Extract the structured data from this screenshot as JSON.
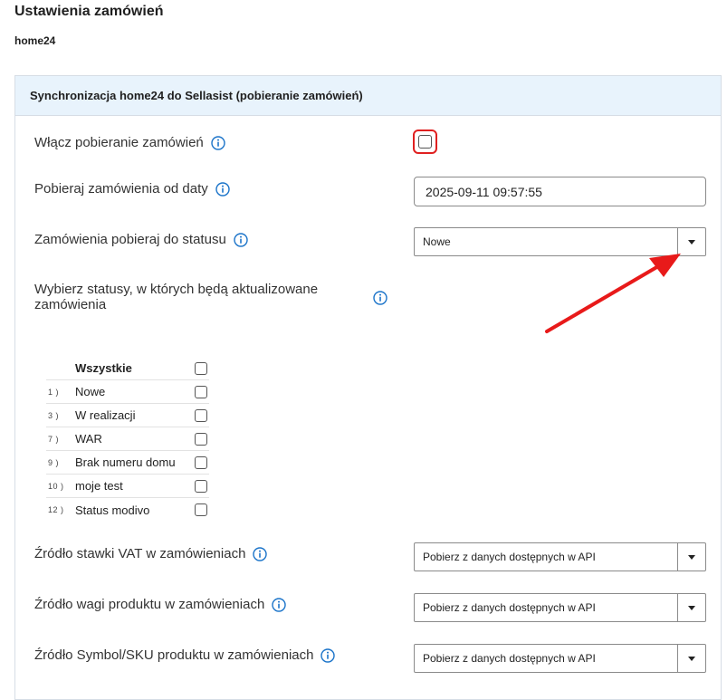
{
  "page": {
    "title": "Ustawienia zamówień",
    "subtitle": "home24"
  },
  "panel": {
    "header": "Synchronizacja home24 do Sellasist (pobieranie zamówień)",
    "enable_label": "Włącz pobieranie zamówień",
    "date_label": "Pobieraj zamówienia od daty",
    "date_value": "2025-09-11 09:57:55",
    "status_label": "Zamówienia pobieraj do statusu",
    "status_value": "Nowe",
    "update_label_line1": "Wybierz statusy, w których będą aktualizowane",
    "update_label_line2": "zamówienia",
    "statuses": {
      "all_label": "Wszystkie",
      "items": [
        {
          "num": "1 )",
          "label": "Nowe"
        },
        {
          "num": "3 )",
          "label": "W realizacji"
        },
        {
          "num": "7 )",
          "label": "WAR"
        },
        {
          "num": "9 )",
          "label": "Brak numeru domu"
        },
        {
          "num": "10 )",
          "label": "moje test"
        },
        {
          "num": "12 )",
          "label": "Status modivo"
        }
      ]
    },
    "vat_label": "Źródło stawki VAT w zamówieniach",
    "vat_value": "Pobierz z danych dostępnych w API",
    "weight_label": "Źródło wagi produktu w zamówieniach",
    "weight_value": "Pobierz z danych dostępnych w API",
    "sku_label": "Źródło Symbol/SKU produktu w zamówieniach",
    "sku_value": "Pobierz z danych dostępnych w API"
  },
  "colors": {
    "accent": "#1a73c9",
    "highlight": "#e02020",
    "header_bg": "#e8f3fc"
  },
  "icons": {
    "info": "info-circle-icon",
    "caret": "caret-down-icon",
    "annotation": "red-arrow-annotation"
  }
}
